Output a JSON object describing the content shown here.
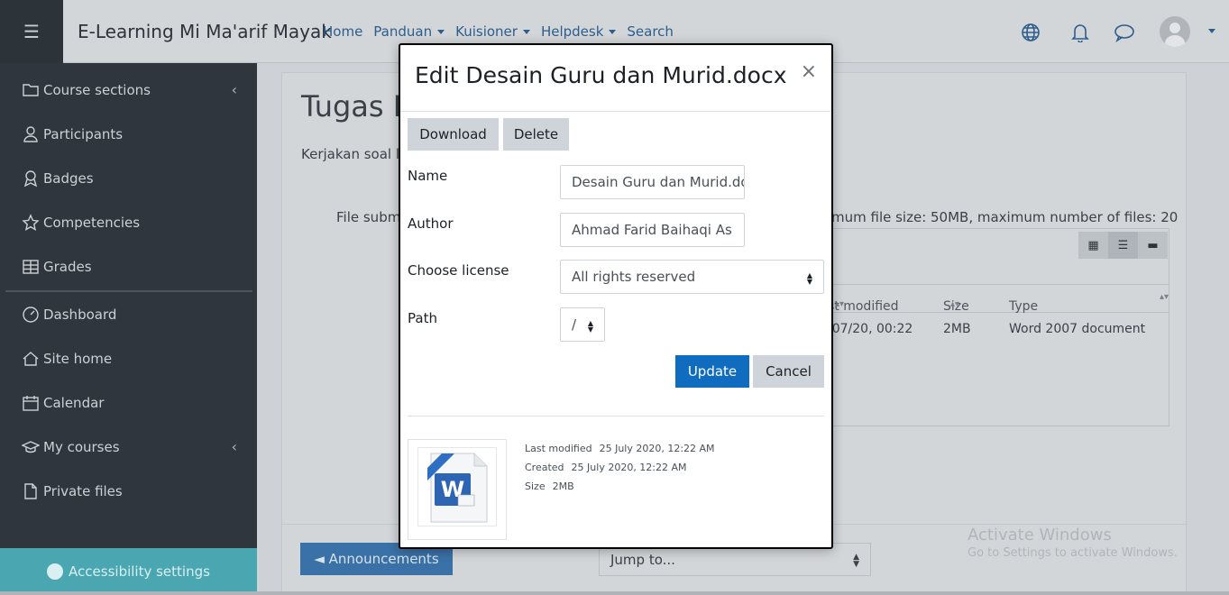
{
  "navbar": {
    "brand": "E-Learning Mi Ma'arif Mayak",
    "links": [
      {
        "label": "Home",
        "dropdown": false
      },
      {
        "label": "Panduan",
        "dropdown": true
      },
      {
        "label": "Kuisioner",
        "dropdown": true
      },
      {
        "label": "Helpdesk",
        "dropdown": true
      },
      {
        "label": "Search",
        "dropdown": false
      }
    ],
    "icons": [
      "globe-icon",
      "bell-icon",
      "chat-icon",
      "avatar"
    ]
  },
  "sidebar": {
    "items": [
      {
        "label": "Course sections",
        "icon": "folder-icon"
      },
      {
        "label": "Participants",
        "icon": "users-icon"
      },
      {
        "label": "Badges",
        "icon": "badge-icon"
      },
      {
        "label": "Competencies",
        "icon": "star-icon"
      },
      {
        "label": "Grades",
        "icon": "table-icon"
      },
      {
        "label": "Dashboard",
        "icon": "dashboard-icon"
      },
      {
        "label": "Site home",
        "icon": "home-icon"
      },
      {
        "label": "Calendar",
        "icon": "calendar-icon"
      },
      {
        "label": "My courses",
        "icon": "graduation-cap-icon"
      },
      {
        "label": "Private files",
        "icon": "file-icon"
      }
    ],
    "accessibility": "Accessibility settings"
  },
  "main": {
    "title": "Tugas E",
    "description": "Kerjakan soal l",
    "file_submission_label": "File subm",
    "max_info": "mum file size: 50MB, maximum number of files: 20",
    "table": {
      "headers": [
        "st modified",
        "Size",
        "Type"
      ],
      "rows": [
        [
          "/07/20, 00:22",
          "2MB",
          "Word 2007 document"
        ]
      ]
    },
    "announcements_button": "◄ Announcements",
    "jump_to": "Jump to...",
    "watermark_line1": "Activate Windows",
    "watermark_line2": "Go to Settings to activate Windows."
  },
  "modal": {
    "title": "Edit Desain Guru dan Murid.docx",
    "close": "×",
    "download_button": "Download",
    "delete_button": "Delete",
    "name_label": "Name",
    "name_value": "Desain Guru dan Murid.docx",
    "author_label": "Author",
    "author_value": "Ahmad Farid Baihaqi As",
    "license_label": "Choose license",
    "license_value": "All rights reserved",
    "path_label": "Path",
    "path_value": "/",
    "update_button": "Update",
    "cancel_button": "Cancel",
    "meta": {
      "last_modified_label": "Last modified",
      "last_modified_value": "25 July 2020, 12:22 AM",
      "created_label": "Created",
      "created_value": "25 July 2020, 12:22 AM",
      "size_label": "Size",
      "size_value": "2MB"
    }
  },
  "colors": {
    "primary": "#0f6cbf",
    "sidebar_bg": "#2f363d",
    "accessibility_bg": "#4aa7b1"
  }
}
